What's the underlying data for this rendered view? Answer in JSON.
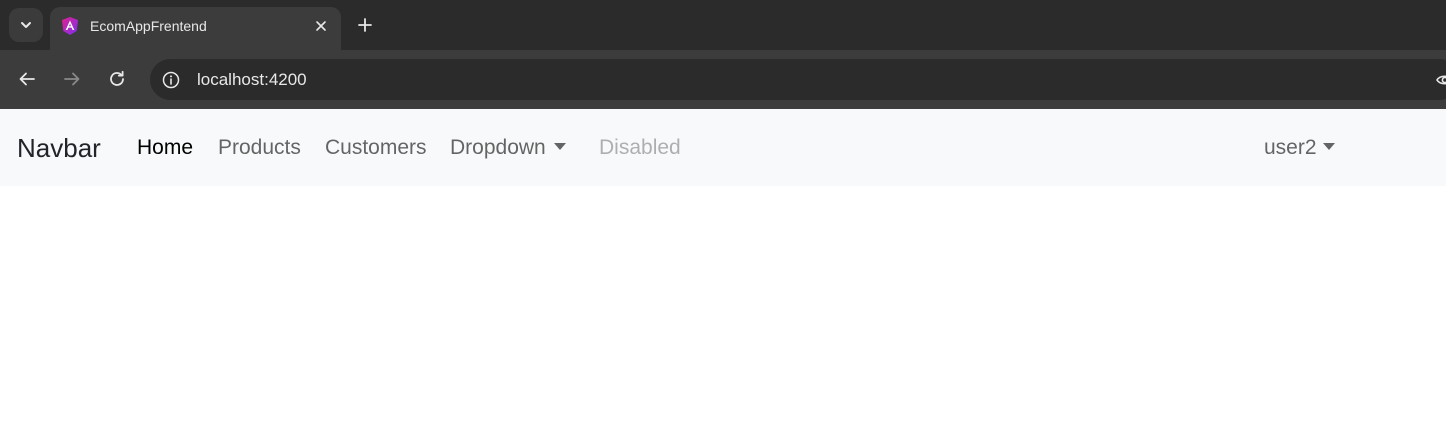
{
  "browser": {
    "tab": {
      "title": "EcomAppFrentend",
      "favicon_icon": "angular-icon",
      "close_icon": "close-icon"
    },
    "tab_list_icon": "chevron-down-icon",
    "new_tab_icon": "plus-icon",
    "toolbar": {
      "back_icon": "arrow-left-icon",
      "forward_icon": "arrow-right-icon",
      "reload_icon": "reload-icon",
      "site_info_icon": "info-icon",
      "url": "localhost:4200"
    }
  },
  "navbar": {
    "brand": "Navbar",
    "links": [
      {
        "label": "Home",
        "state": "active"
      },
      {
        "label": "Products",
        "state": "normal"
      },
      {
        "label": "Customers",
        "state": "normal"
      },
      {
        "label": "Dropdown",
        "state": "dropdown"
      },
      {
        "label": "Disabled",
        "state": "disabled"
      }
    ],
    "user_menu": {
      "label": "user2"
    }
  },
  "colors": {
    "chrome_dark": "#2b2b2b",
    "chrome_toolbar": "#3c3c3c",
    "navbar_bg": "#f8f9fa",
    "favicon_magenta": "#e0218a"
  }
}
